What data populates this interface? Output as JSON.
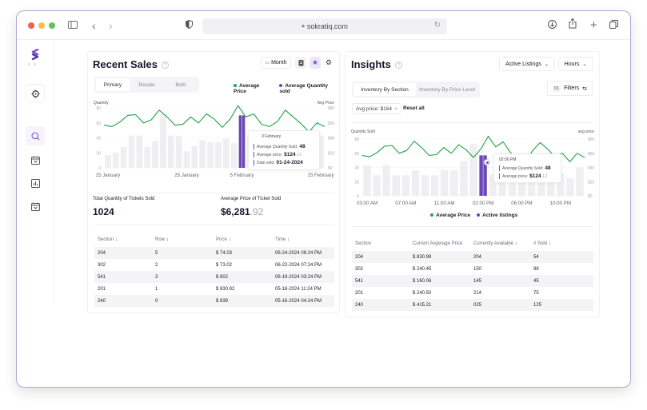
{
  "browser": {
    "url": "sokratiq.com",
    "icons": [
      "sidebar-toggle-icon",
      "back-icon",
      "forward-icon",
      "privacy-shield-icon",
      "lock-icon",
      "reload-icon",
      "download-icon",
      "share-icon",
      "new-tab-icon",
      "tabs-overview-icon"
    ]
  },
  "sidebar": {
    "items": [
      {
        "name": "target-icon",
        "glyph": "⊙"
      },
      {
        "name": "search-icon",
        "glyph": "⚲"
      },
      {
        "name": "calendar-icon",
        "glyph": "▤"
      },
      {
        "name": "bar-chart-icon",
        "glyph": "▥"
      },
      {
        "name": "calendar-alt-icon",
        "glyph": "▤"
      }
    ],
    "collapse_glyph": "‹ ›"
  },
  "recent_sales": {
    "title": "Recent Sales",
    "help": "?",
    "period_button": "Month",
    "period_icon": "calendar-icon",
    "tabs": [
      "Primary",
      "Resale",
      "Both"
    ],
    "active_tab": "Primary",
    "legend": [
      {
        "label": "Average Price",
        "color": "#1fa24a"
      },
      {
        "label": "Average Quantity sold",
        "color": "#6b48b8"
      }
    ],
    "tooltip": {
      "date": "3 February",
      "qty_label": "Average Quantity Sold:",
      "qty_value": "48",
      "price_label": "Average price:",
      "price_main": "$124",
      "price_cents": ".12",
      "date_label": "Date sold:",
      "date_value": "01-24-2024"
    },
    "stats": {
      "total_label": "Total Quantity of Tickets Sold",
      "total_value": "1024",
      "avg_label": "Average Price of Ticket Sold",
      "avg_main": "$6,281",
      "avg_cents": ".92"
    },
    "table": {
      "headers": [
        "Section",
        "Row",
        "Price",
        "Time"
      ],
      "sort_glyph": "↓",
      "rows": [
        [
          "204",
          "5",
          "$ 74.03",
          "06-24-2024 06:24 PM"
        ],
        [
          "302",
          "2",
          "$ 73.02",
          "06-22-2024 07:24 PM"
        ],
        [
          "541",
          "3",
          "$ 802",
          "06-19-2024 03:24 PM"
        ],
        [
          "201",
          "1",
          "$ 830.92",
          "05-18-2024 11:24 PM"
        ],
        [
          "240",
          "0",
          "$ 839",
          "05-16-2024 04:24 PM"
        ]
      ]
    }
  },
  "insights": {
    "title": "Insights",
    "help": "?",
    "dropdown_listing": "Active Listings",
    "dropdown_period": "Hours",
    "tabs": [
      "Inventory By Section",
      "Inventory By Price Level"
    ],
    "active_tab": "Inventory By Section",
    "filters_count": "01",
    "filters_label": "Filters",
    "filter_chip": "Avg price: $164",
    "reset_label": "Reset all",
    "legend": [
      {
        "label": "Average Price",
        "color": "#1fa24a"
      },
      {
        "label": "Active listings",
        "color": "#6b48b8"
      }
    ],
    "tooltip": {
      "time": "02:00 PM",
      "qty_label": "Average Quantity Sold:",
      "qty_value": "48",
      "price_label": "Average price:",
      "price_main": "$124",
      "price_cents": ".12"
    },
    "table": {
      "headers": [
        "Section",
        "Current Avgerage Price",
        "Currently Available",
        "# Sold"
      ],
      "sort_glyph": "↓",
      "rows": [
        [
          "204",
          "$ 830.98",
          "204",
          "54"
        ],
        [
          "302",
          "$ 240.45",
          "150",
          "98"
        ],
        [
          "541",
          "$ 160.06",
          "145",
          "45"
        ],
        [
          "201",
          "$ 240.50",
          "214",
          "75"
        ],
        [
          "240",
          "$ 415.21",
          "025",
          "125"
        ]
      ]
    }
  },
  "chart_data": [
    {
      "type": "bar",
      "title": "Recent Sales",
      "ylabel": "Quantity",
      "y2label": "Avg Price",
      "ylim": [
        0,
        80
      ],
      "y2lim": [
        0,
        80
      ],
      "yticks": [
        "0",
        "20",
        "40",
        "60",
        "80"
      ],
      "y2ticks": [
        "$0",
        "$20",
        "$40",
        "$60",
        "$80"
      ],
      "xtick_labels": [
        "15 January",
        "25 January",
        "5 February",
        "15 February"
      ],
      "xtick_index": [
        0,
        10,
        17,
        27
      ],
      "highlight_index": 17,
      "series": [
        {
          "name": "Average Quantity sold",
          "kind": "bar",
          "values": [
            17,
            20,
            28,
            43,
            43,
            28,
            36,
            72,
            43,
            43,
            22,
            29,
            37,
            34,
            34,
            39,
            33,
            70,
            43,
            29,
            30,
            31,
            35,
            30,
            28,
            28,
            43,
            43
          ]
        },
        {
          "name": "Average Price",
          "kind": "line",
          "values": [
            57,
            55,
            61,
            70,
            71,
            60,
            64,
            77,
            68,
            57,
            58,
            68,
            60,
            72,
            65,
            54,
            65,
            83,
            68,
            72,
            58,
            55,
            62,
            77,
            68,
            59,
            48,
            60,
            55
          ]
        }
      ]
    },
    {
      "type": "bar",
      "title": "Insights",
      "ylabel": "Quantity Sold",
      "y2label": "avg price",
      "ylim": [
        0,
        80
      ],
      "y2lim": [
        0,
        80
      ],
      "yticks": [
        "0",
        "20",
        "40",
        "60",
        "80"
      ],
      "y2ticks": [
        "$0",
        "$20",
        "$40",
        "$60",
        "$80"
      ],
      "xtick_labels": [
        "03:00 AM",
        "07:00 AM",
        "11:00 AM",
        "02:00 PM",
        "06:00 PM",
        "10:00 PM"
      ],
      "xtick_index": [
        0,
        4,
        8,
        12,
        16,
        20
      ],
      "highlight_index": 12,
      "series": [
        {
          "name": "Active listings",
          "kind": "bar",
          "values": [
            43,
            29,
            43,
            29,
            29,
            36,
            29,
            29,
            36,
            36,
            49,
            73,
            57,
            30,
            30,
            30,
            30,
            30,
            30,
            30,
            31,
            25,
            40
          ]
        },
        {
          "name": "Average Price",
          "kind": "line",
          "values": [
            57,
            55,
            61,
            70,
            71,
            60,
            64,
            77,
            68,
            57,
            58,
            68,
            60,
            72,
            65,
            54,
            66,
            84,
            69,
            76,
            61,
            51,
            48,
            64,
            75,
            66,
            55,
            60,
            48,
            60,
            54
          ]
        }
      ]
    }
  ]
}
